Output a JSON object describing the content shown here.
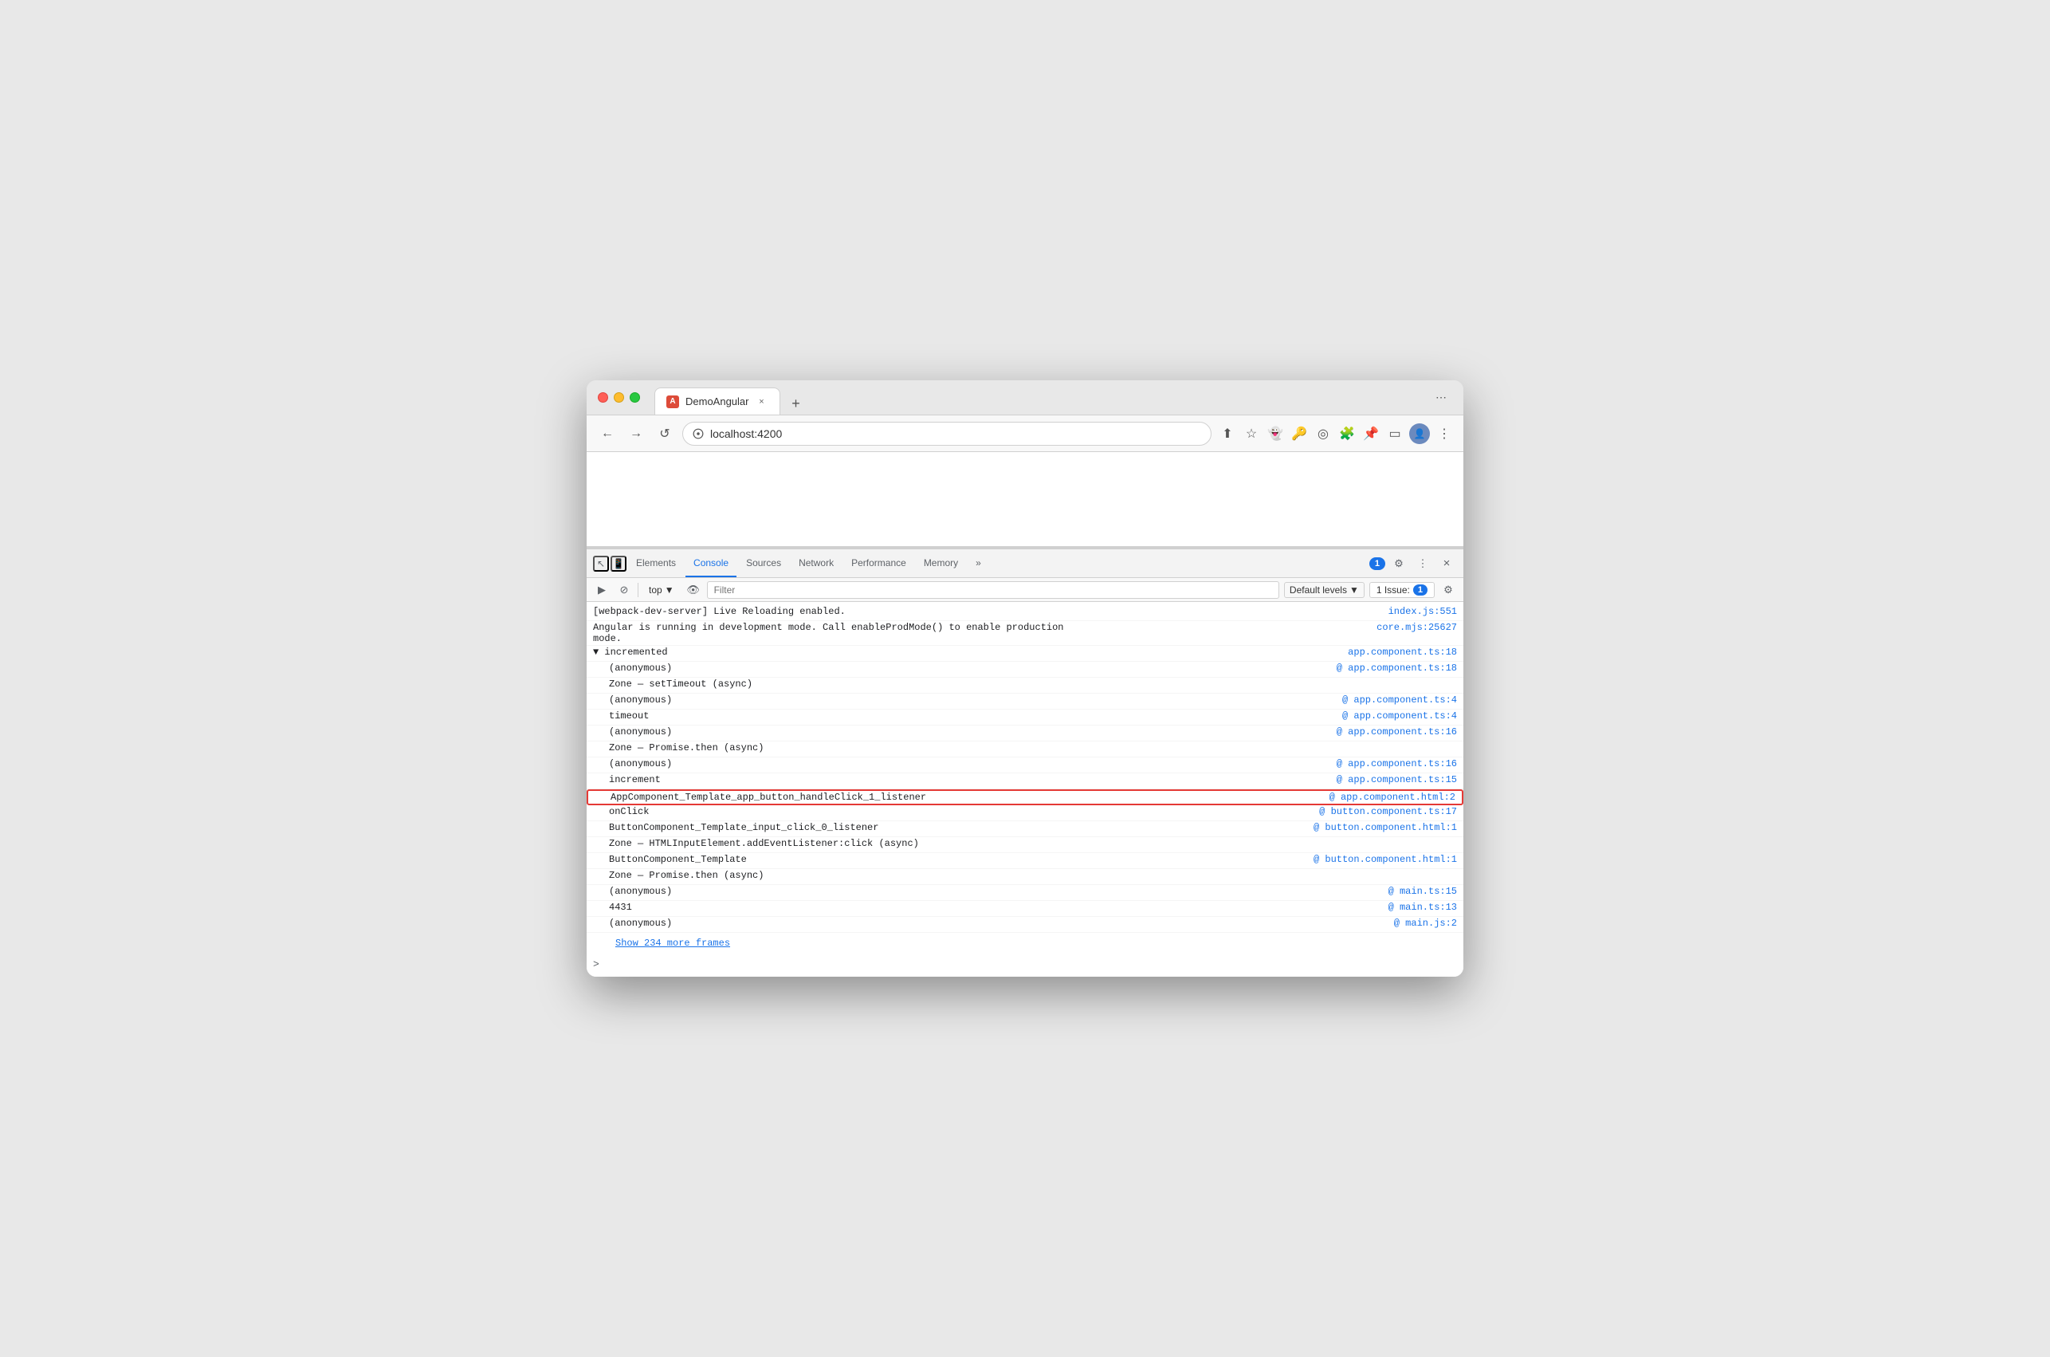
{
  "browser": {
    "traffic_lights": [
      "red",
      "yellow",
      "green"
    ],
    "tab": {
      "label": "DemoAngular",
      "close": "×",
      "icon": "A"
    },
    "new_tab": "+",
    "nav": {
      "back": "←",
      "forward": "→",
      "reload": "↺",
      "url": "localhost:4200"
    }
  },
  "devtools": {
    "tabs": [
      "Elements",
      "Console",
      "Sources",
      "Network",
      "Performance",
      "Memory"
    ],
    "active_tab": "Console",
    "more": "»",
    "badge": "1",
    "settings_icon": "⚙",
    "more_options": "⋮",
    "close": "×"
  },
  "console_toolbar": {
    "execute": "▶",
    "stop": "🚫",
    "top_label": "top",
    "dropdown_arrow": "▼",
    "eye_icon": "👁",
    "filter_placeholder": "Filter",
    "default_levels": "Default levels",
    "dropdown_arrow2": "▼",
    "issue_label": "1 Issue:",
    "issue_count": "1",
    "settings": "⚙"
  },
  "console_lines": [
    {
      "id": 1,
      "text": "[webpack-dev-server] Live Reloading enabled.",
      "link": "index.js:551",
      "indent": false,
      "highlighted": false
    },
    {
      "id": 2,
      "text": "Angular is running in development mode. Call enableProdMode() to enable production\nmode.",
      "link": "core.mjs:25627",
      "indent": false,
      "highlighted": false
    },
    {
      "id": 3,
      "text": "▼ incremented",
      "link": "app.component.ts:18",
      "indent": false,
      "highlighted": false
    },
    {
      "id": 4,
      "text": "  (anonymous)",
      "link": "app.component.ts:18",
      "link_prefix": "@ ",
      "indent": true,
      "highlighted": false
    },
    {
      "id": 5,
      "text": "  Zone — setTimeout (async)",
      "link": "",
      "indent": true,
      "highlighted": false
    },
    {
      "id": 6,
      "text": "  (anonymous)",
      "link": "app.component.ts:4",
      "link_prefix": "@ ",
      "indent": true,
      "highlighted": false
    },
    {
      "id": 7,
      "text": "  timeout",
      "link": "app.component.ts:4",
      "link_prefix": "@ ",
      "indent": true,
      "highlighted": false
    },
    {
      "id": 8,
      "text": "  (anonymous)",
      "link": "app.component.ts:16",
      "link_prefix": "@ ",
      "indent": true,
      "highlighted": false
    },
    {
      "id": 9,
      "text": "  Zone — Promise.then (async)",
      "link": "",
      "indent": true,
      "highlighted": false
    },
    {
      "id": 10,
      "text": "  (anonymous)",
      "link": "app.component.ts:16",
      "link_prefix": "@ ",
      "indent": true,
      "highlighted": false
    },
    {
      "id": 11,
      "text": "  increment",
      "link": "app.component.ts:15",
      "link_prefix": "@ ",
      "indent": true,
      "highlighted": false
    },
    {
      "id": 12,
      "text": "  AppComponent_Template_app_button_handleClick_1_listener",
      "link": "app.component.html:2",
      "link_prefix": "@ ",
      "indent": true,
      "highlighted": true
    },
    {
      "id": 13,
      "text": "  onClick",
      "link": "button.component.ts:17",
      "link_prefix": "@ ",
      "indent": true,
      "highlighted": false
    },
    {
      "id": 14,
      "text": "  ButtonComponent_Template_input_click_0_listener",
      "link": "button.component.html:1",
      "link_prefix": "@ ",
      "indent": true,
      "highlighted": false
    },
    {
      "id": 15,
      "text": "  Zone — HTMLInputElement.addEventListener:click (async)",
      "link": "",
      "indent": true,
      "highlighted": false
    },
    {
      "id": 16,
      "text": "  ButtonComponent_Template",
      "link": "button.component.html:1",
      "link_prefix": "@ ",
      "indent": true,
      "highlighted": false
    },
    {
      "id": 17,
      "text": "  Zone — Promise.then (async)",
      "link": "",
      "indent": true,
      "highlighted": false
    },
    {
      "id": 18,
      "text": "  (anonymous)",
      "link": "main.ts:15",
      "link_prefix": "@ ",
      "indent": true,
      "highlighted": false
    },
    {
      "id": 19,
      "text": "  4431",
      "link": "main.ts:13",
      "link_prefix": "@ ",
      "indent": true,
      "highlighted": false
    },
    {
      "id": 20,
      "text": "  (anonymous)",
      "link": "main.js:2",
      "link_prefix": "@ ",
      "indent": true,
      "highlighted": false
    }
  ],
  "show_more": "Show 234 more frames",
  "prompt": ">"
}
